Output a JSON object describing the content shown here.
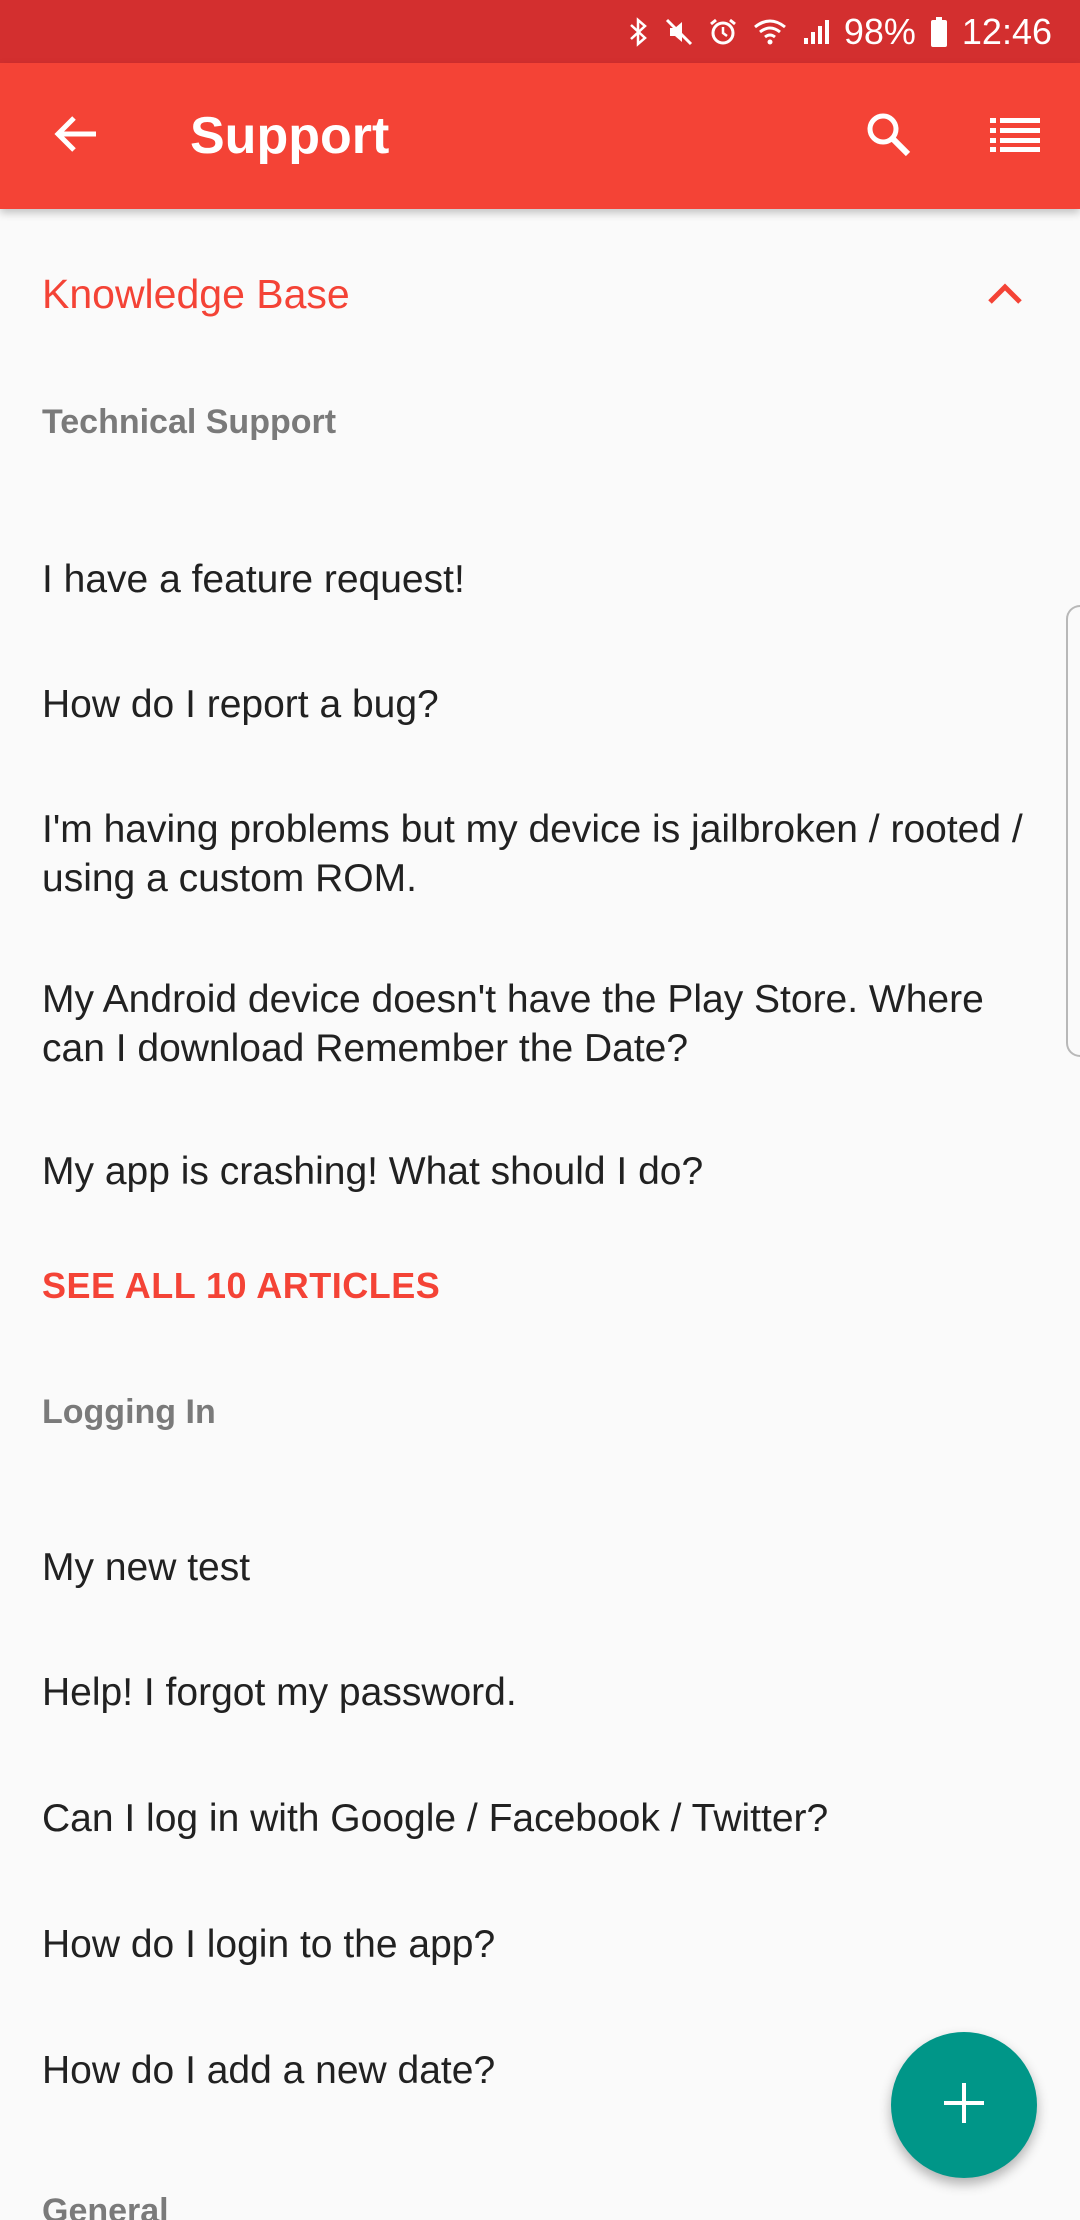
{
  "status_bar": {
    "battery": "98%",
    "time": "12:46",
    "icons": [
      "bluetooth-icon",
      "mute-icon",
      "alarm-icon",
      "wifi-icon",
      "signal-icon",
      "battery-icon"
    ]
  },
  "app_bar": {
    "title": "Support",
    "back_icon": "arrow-back-icon",
    "search_icon": "search-icon",
    "list_icon": "list-icon",
    "color": "#f44336"
  },
  "knowledge_base": {
    "title": "Knowledge Base",
    "expanded": true,
    "sections": [
      {
        "label": "Technical Support",
        "articles": [
          "I have a feature request!",
          "How do I report a bug?",
          "I'm having problems but my device is jailbroken / rooted / using a custom ROM.",
          "My Android device doesn't have the Play Store. Where can I download Remember the Date?",
          "My app is crashing! What should I do?"
        ],
        "see_all": "SEE ALL 10 ARTICLES"
      },
      {
        "label": "Logging In",
        "articles": [
          "My new test",
          "Help! I forgot my password.",
          "Can I log in with Google / Facebook / Twitter?",
          "How do I login to the app?",
          "How do I add a new date?"
        ]
      },
      {
        "label": "General"
      }
    ]
  },
  "fab": {
    "icon": "plus-icon",
    "color": "#009688"
  }
}
